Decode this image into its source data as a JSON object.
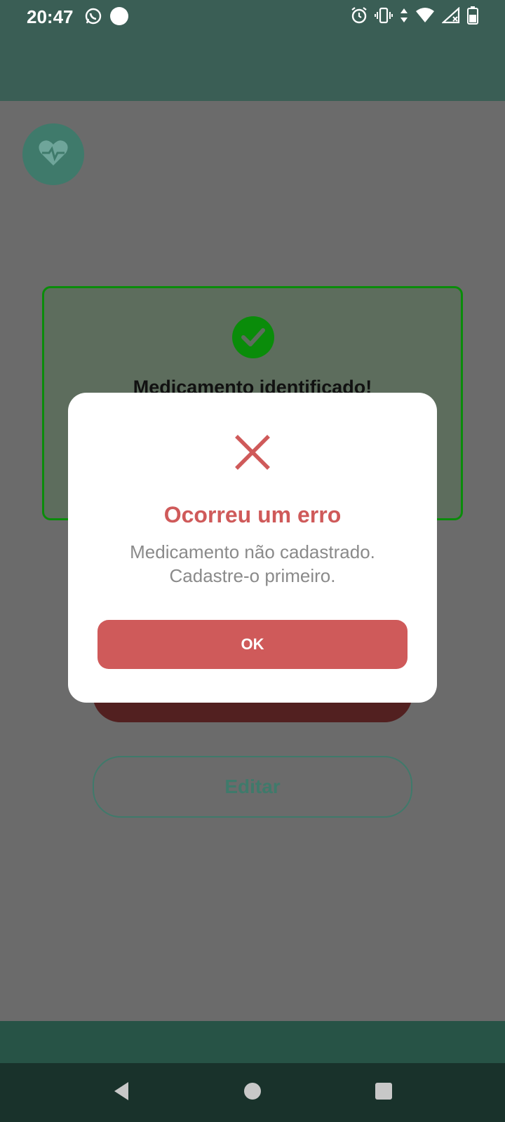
{
  "status_bar": {
    "time": "20:47",
    "left_icons": [
      "whatsapp-icon",
      "notification-dot-icon"
    ],
    "right_icons": [
      "alarm-icon",
      "vibrate-icon",
      "data-arrows-icon",
      "wifi-icon",
      "signal-icon",
      "battery-icon"
    ]
  },
  "app": {
    "logo_icon": "heart-pulse-icon",
    "result_card": {
      "icon": "check-circle-icon",
      "title": "Medicamento identificado!"
    },
    "edit_label": "Editar"
  },
  "dialog": {
    "icon": "error-x-icon",
    "title": "Ocorreu um erro",
    "message_line1": "Medicamento não cadastrado.",
    "message_line2": "Cadastre-o primeiro.",
    "ok_label": "OK"
  },
  "nav_bar": {
    "buttons": [
      "back-icon",
      "home-icon",
      "recents-icon"
    ]
  },
  "colors": {
    "app_bar": "#3a5e55",
    "overlay_bg": "#6b6b6b",
    "success": "#0a8c0a",
    "error": "#cf5a5a",
    "nav_bar": "#19322b"
  }
}
